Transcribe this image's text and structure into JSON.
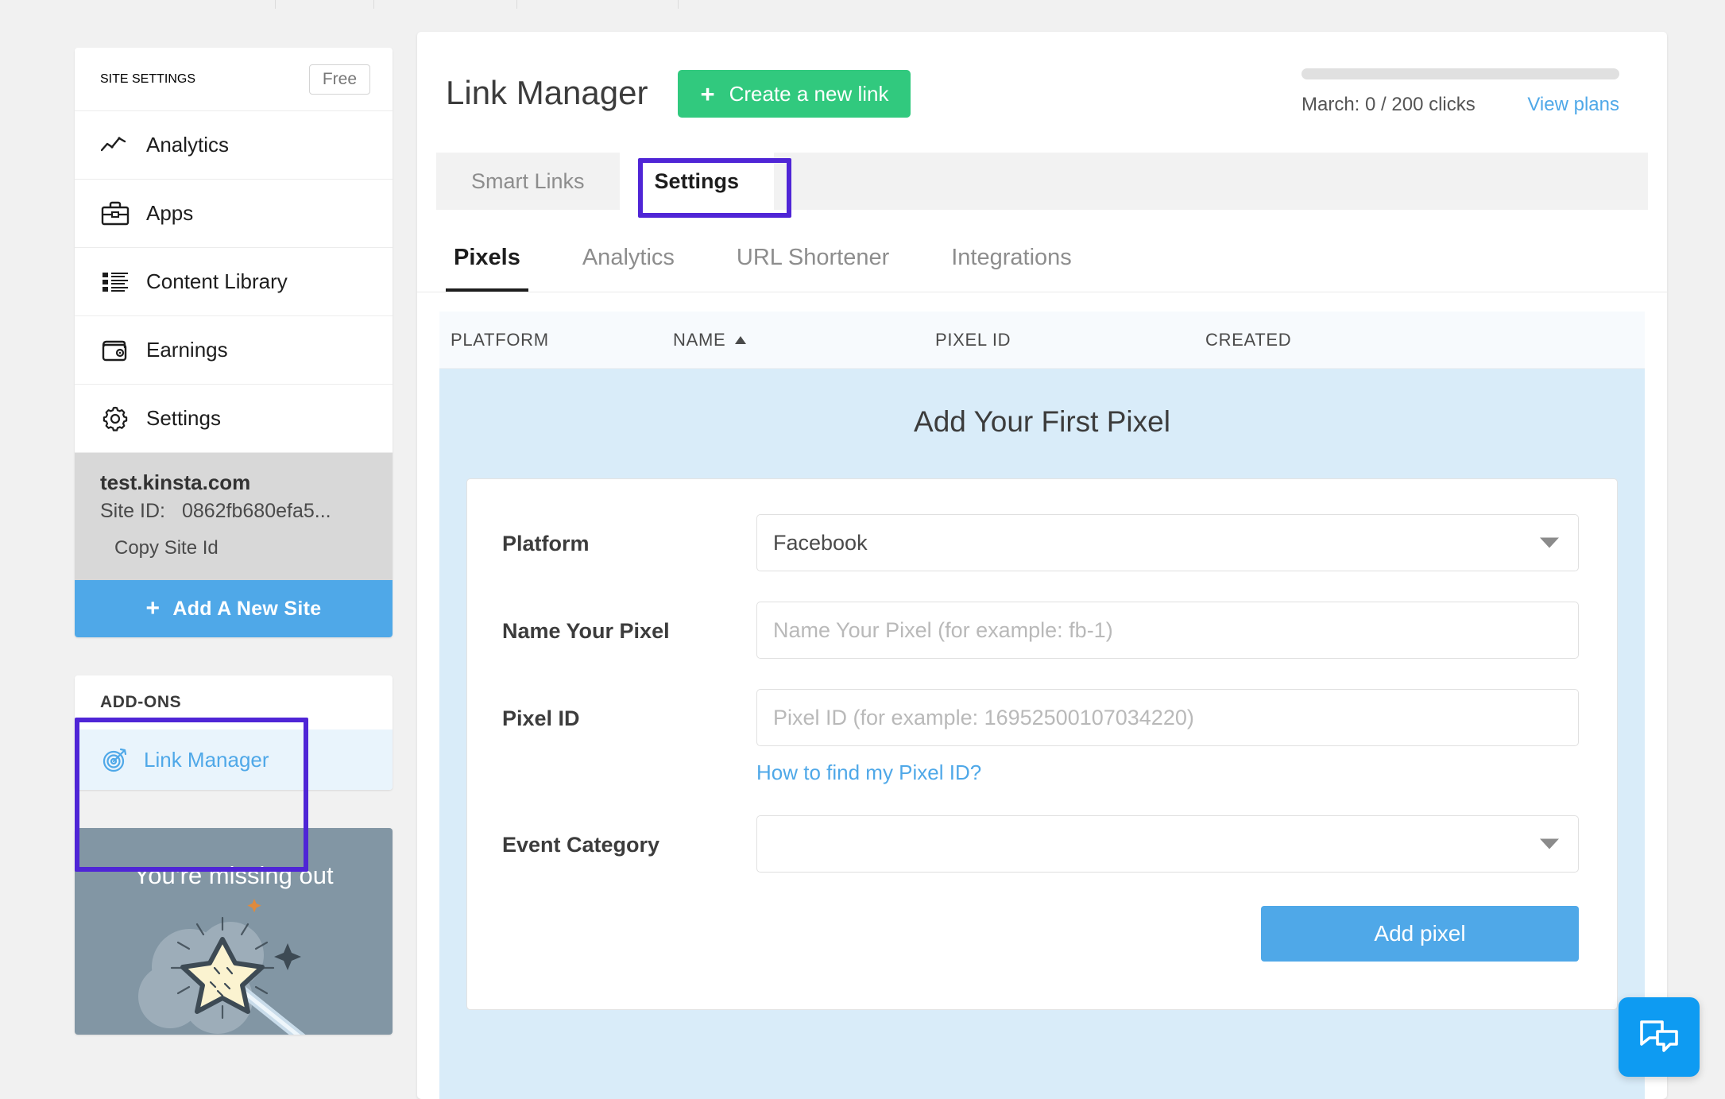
{
  "sidebar": {
    "header_title": "SITE SETTINGS",
    "plan_badge": "Free",
    "nav_items": [
      {
        "label": "Analytics",
        "icon": "line-chart-icon"
      },
      {
        "label": "Apps",
        "icon": "briefcase-icon"
      },
      {
        "label": "Content Library",
        "icon": "list-icon"
      },
      {
        "label": "Earnings",
        "icon": "wallet-icon"
      },
      {
        "label": "Settings",
        "icon": "gear-icon"
      }
    ],
    "site": {
      "domain": "test.kinsta.com",
      "site_id_label": "Site ID:",
      "site_id_value": "0862fb680efa5...",
      "copy_label": "Copy Site Id"
    },
    "add_site_label": "Add A New Site",
    "add_site_plus": "+",
    "addons": {
      "title": "ADD-ONS",
      "items": [
        {
          "label": "Link Manager",
          "icon": "target-icon"
        }
      ]
    },
    "promo": {
      "title": "You're missing out"
    }
  },
  "header": {
    "page_title": "Link Manager",
    "create_link_label": "Create a new link",
    "create_link_plus": "+",
    "quota_text": "March: 0 / 200 clicks",
    "quota_percent": 0,
    "view_plans_label": "View plans"
  },
  "tabs": [
    {
      "label": "Smart Links",
      "active": false
    },
    {
      "label": "Settings",
      "active": true
    }
  ],
  "subtabs": [
    {
      "label": "Pixels",
      "active": true
    },
    {
      "label": "Analytics",
      "active": false
    },
    {
      "label": "URL Shortener",
      "active": false
    },
    {
      "label": "Integrations",
      "active": false
    }
  ],
  "table": {
    "columns": [
      "PLATFORM",
      "NAME",
      "PIXEL ID",
      "CREATED"
    ],
    "sorted_column": "NAME",
    "sort_direction": "ascending",
    "rows": []
  },
  "empty_state": {
    "title": "Add Your First Pixel",
    "form": {
      "platform": {
        "label": "Platform",
        "value": "Facebook"
      },
      "name": {
        "label": "Name Your Pixel",
        "value": "",
        "placeholder": "Name Your Pixel (for example: fb-1)"
      },
      "pixel_id": {
        "label": "Pixel ID",
        "value": "",
        "placeholder": "Pixel ID (for example: 16952500107034220)",
        "help_link": "How to find my Pixel ID?"
      },
      "event_category": {
        "label": "Event Category",
        "value": ""
      },
      "submit_label": "Add pixel"
    }
  },
  "chat": {
    "icon": "chat-bubbles-icon"
  },
  "colors": {
    "accent_blue": "#4fa8e8",
    "green": "#31c97e",
    "annotation_purple": "#4f25d6",
    "panel_blue": "#d9ecf9",
    "chat_blue": "#0e9bf2"
  }
}
